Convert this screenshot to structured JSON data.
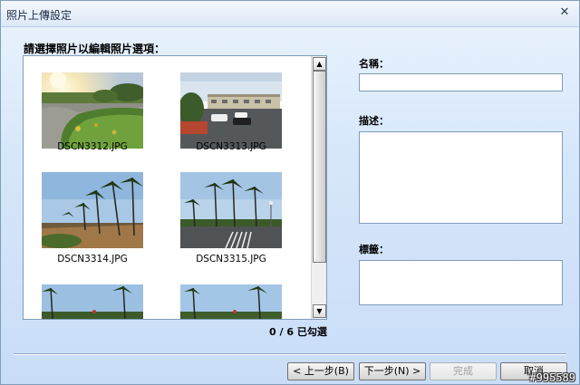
{
  "window": {
    "title": "照片上傳設定",
    "close_glyph": "✕"
  },
  "gallery": {
    "prompt": "請選擇照片以編輯照片選項：",
    "items": [
      {
        "filename": "DSCN3312.JPG",
        "scene": "garden-sunset"
      },
      {
        "filename": "DSCN3313.JPG",
        "scene": "parking-lot"
      },
      {
        "filename": "DSCN3314.JPG",
        "scene": "palm-path"
      },
      {
        "filename": "DSCN3315.JPG",
        "scene": "palm-road"
      },
      {
        "filename": "",
        "scene": "palm-partial"
      },
      {
        "filename": "",
        "scene": "palm-partial"
      }
    ],
    "selection_count": "0 / 6 已勾選"
  },
  "form": {
    "name_label": "名稱：",
    "name_value": "",
    "description_label": "描述：",
    "description_value": "",
    "tags_label": "標籤：",
    "tags_value": ""
  },
  "buttons": {
    "back": "< 上一步(B)",
    "next": "下一步(N) >",
    "finish": "完成",
    "cancel": "取消"
  },
  "watermark": "#995589",
  "colors": {
    "window_bg": "#c9ddf7",
    "border": "#7f9db9"
  }
}
